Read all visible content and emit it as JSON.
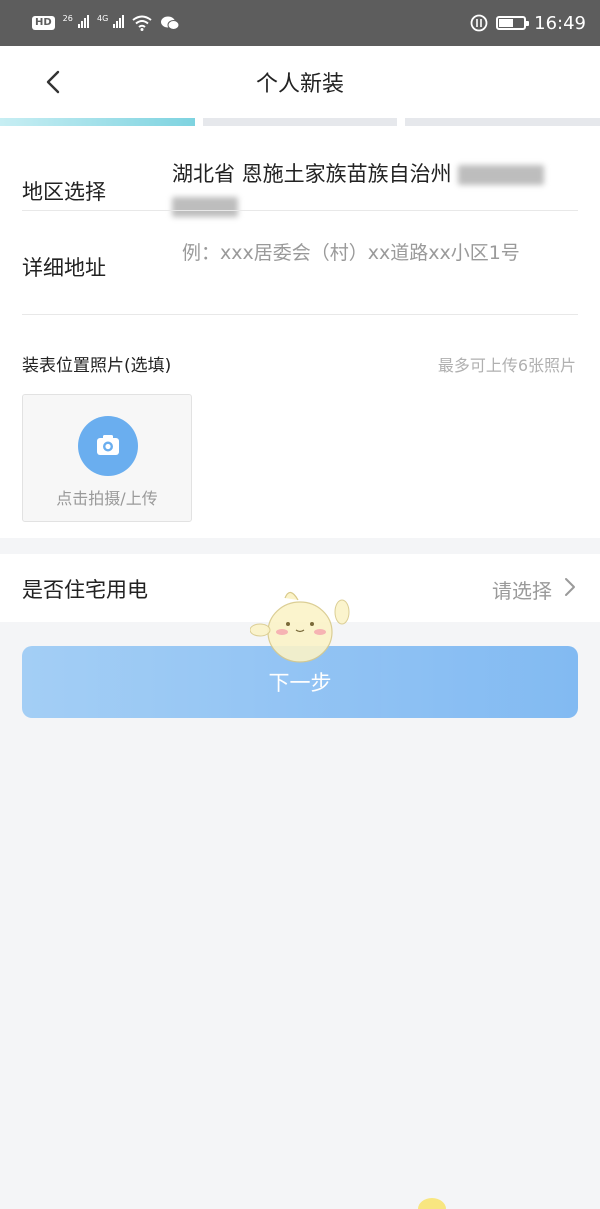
{
  "status_bar": {
    "hd_label": "HD",
    "sim1_label": "26",
    "sim2_label": "4G",
    "time": "16:49"
  },
  "nav": {
    "title": "个人新装"
  },
  "form": {
    "region_label": "地区选择",
    "region_value": "湖北省 恩施土家族苗族自治州",
    "address_label": "详细地址",
    "address_placeholder": "例：xxx居委会（村）xx道路xx小区1号",
    "photo_label": "装表位置照片(选填)",
    "photo_hint": "最多可上传6张照片",
    "upload_text": "点击拍摄/上传",
    "resident_label": "是否住宅用电",
    "resident_value": "请选择"
  },
  "next_button": "下一步",
  "colors": {
    "accent": "#7cb7f2",
    "progress_active": "#7ed3e0",
    "status_bar": "#5d5d5d"
  }
}
